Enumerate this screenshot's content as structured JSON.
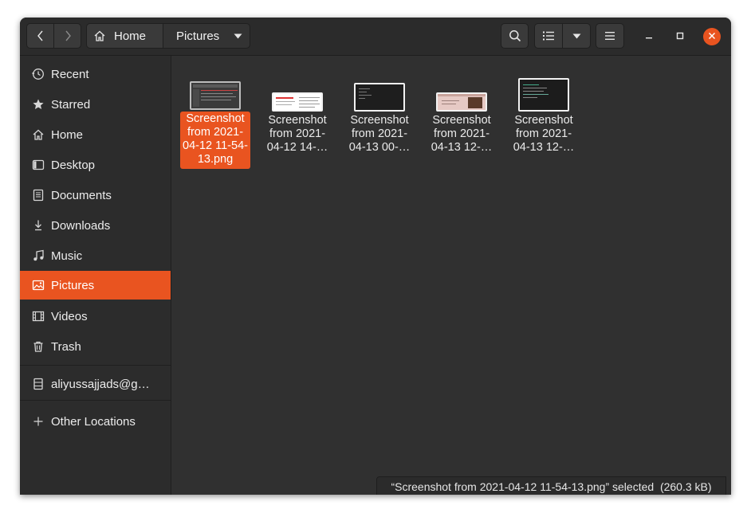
{
  "toolbar": {
    "back_icon": "chevron-left-icon",
    "forward_icon": "chevron-right-icon",
    "breadcrumbs": [
      {
        "label": "Home",
        "icon": "home-icon"
      },
      {
        "label": "Pictures",
        "icon": "dropdown-triangle-icon"
      }
    ],
    "search_icon": "search-icon",
    "view_icon": "list-view-icon",
    "view_menu_icon": "dropdown-triangle-icon",
    "menu_icon": "hamburger-menu-icon"
  },
  "window_controls": {
    "minimize": "minimize-icon",
    "maximize": "maximize-icon",
    "close": "close-icon"
  },
  "sidebar": {
    "items": [
      {
        "label": "Recent",
        "icon": "clock-icon"
      },
      {
        "label": "Starred",
        "icon": "star-icon"
      },
      {
        "label": "Home",
        "icon": "home-icon"
      },
      {
        "label": "Desktop",
        "icon": "desktop-icon"
      },
      {
        "label": "Documents",
        "icon": "document-icon"
      },
      {
        "label": "Downloads",
        "icon": "download-icon"
      },
      {
        "label": "Music",
        "icon": "music-icon"
      },
      {
        "label": "Pictures",
        "icon": "picture-icon",
        "active": true
      },
      {
        "label": "Videos",
        "icon": "film-icon"
      },
      {
        "label": "Trash",
        "icon": "trash-icon"
      }
    ],
    "network_items": [
      {
        "label": "aliyussajjads@g…",
        "icon": "network-drive-icon"
      }
    ],
    "other_locations": {
      "label": "Other Locations",
      "icon": "plus-icon"
    }
  },
  "files": [
    {
      "name": "Screenshot from 2021-04-12 11-54-13.png",
      "lines": [
        "Screenshot",
        "from 2021-",
        "04-12 11-54-",
        "13.png"
      ],
      "selected": true,
      "thumb_style": "dark-window"
    },
    {
      "name": "Screenshot from 2021-04-12 14-…",
      "lines": [
        "Screenshot",
        "from 2021-",
        "04-12 14-…"
      ],
      "selected": false,
      "thumb_style": "white-page"
    },
    {
      "name": "Screenshot from 2021-04-13 00-…",
      "lines": [
        "Screenshot",
        "from 2021-",
        "04-13 00-…"
      ],
      "selected": false,
      "thumb_style": "dark-terminal"
    },
    {
      "name": "Screenshot from 2021-04-13 12-…",
      "lines": [
        "Screenshot",
        "from 2021-",
        "04-13 12-…"
      ],
      "selected": false,
      "thumb_style": "pink-photo"
    },
    {
      "name": "Screenshot from 2021-04-13 12-…",
      "lines": [
        "Screenshot",
        "from 2021-",
        "04-13 12-…"
      ],
      "selected": false,
      "thumb_style": "dark-code"
    }
  ],
  "status": "“Screenshot from 2021-04-12 11-54-13.png” selected  (260.3 kB)",
  "colors": {
    "accent": "#e95420",
    "window_bg": "#303030",
    "sidebar_bg": "#2c2c2c",
    "headerbar_bg": "#2b2b2b"
  }
}
